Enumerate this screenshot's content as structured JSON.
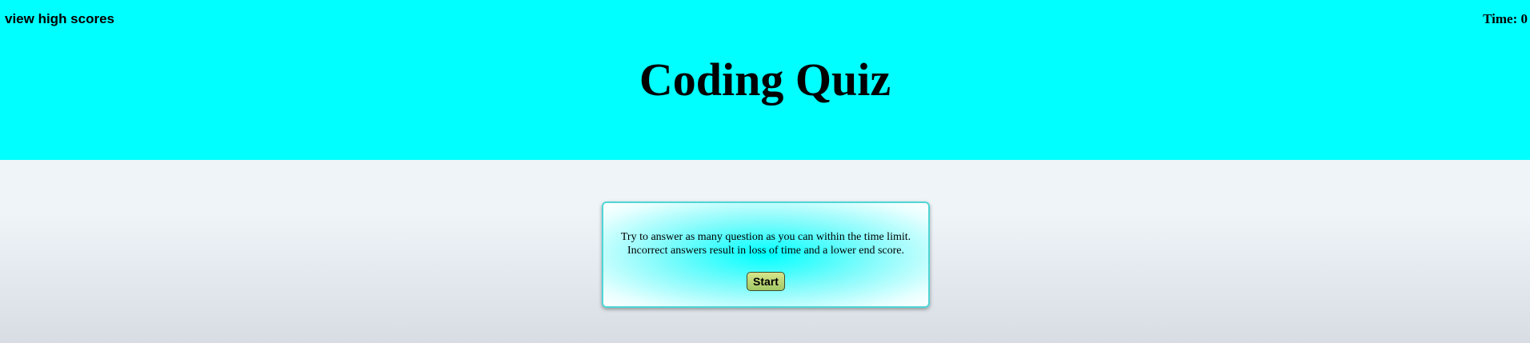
{
  "header": {
    "high_scores_link": "view high scores",
    "timer_label": "Time: 0",
    "title": "Coding Quiz"
  },
  "quiz_card": {
    "instructions_line1": "Try to answer as many question as you can within the time limit.",
    "instructions_line2": "Incorrect answers result in loss of time and a lower end score.",
    "start_label": "Start"
  },
  "colors": {
    "header_background": "#00ffff",
    "page_background": "#eef4f8",
    "start_button": "#c4d97a"
  }
}
